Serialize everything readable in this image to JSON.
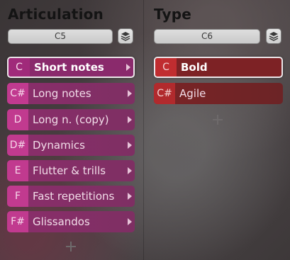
{
  "articulation": {
    "title": "Articulation",
    "key_value": "C5",
    "items": [
      {
        "key": "C",
        "label": "Short notes"
      },
      {
        "key": "C#",
        "label": "Long notes"
      },
      {
        "key": "D",
        "label": "Long n. (copy)"
      },
      {
        "key": "D#",
        "label": "Dynamics"
      },
      {
        "key": "E",
        "label": "Flutter & trills"
      },
      {
        "key": "F",
        "label": "Fast repetitions"
      },
      {
        "key": "F#",
        "label": "Glissandos"
      }
    ],
    "selected_index": 0,
    "accent": "#c13a8f"
  },
  "type": {
    "title": "Type",
    "key_value": "C6",
    "items": [
      {
        "key": "C",
        "label": "Bold"
      },
      {
        "key": "C#",
        "label": "Agile"
      }
    ],
    "selected_index": 0,
    "accent": "#b12a2d"
  },
  "icons": {
    "layers": "layers-icon",
    "chevron": "chevron-right-icon",
    "add": "plus-icon"
  }
}
